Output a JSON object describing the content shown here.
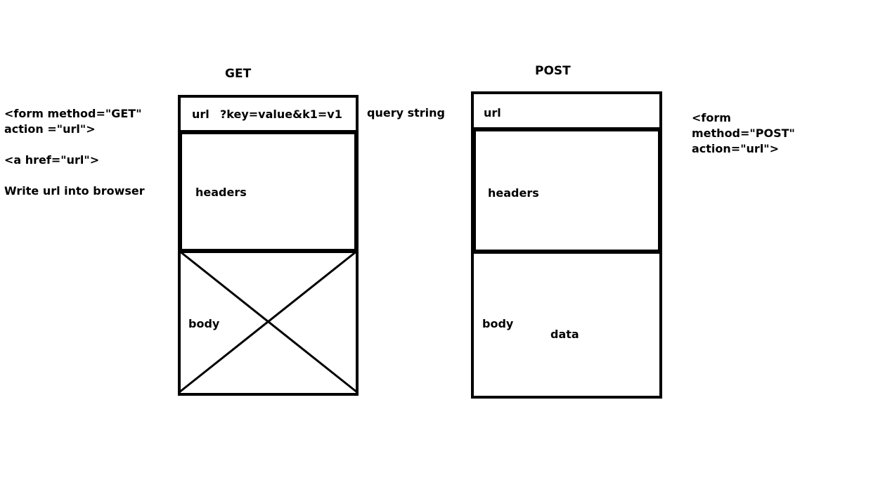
{
  "get": {
    "title": "GET",
    "url_label": "url",
    "query_label": "?key=value&k1=v1",
    "headers_label": "headers",
    "body_label": "body",
    "side_label": "query string",
    "notes": {
      "form_line1": "<form method=\"GET\"",
      "form_line2": "action =\"url\">",
      "anchor": "<a href=\"url\">",
      "browser": "Write url into browser"
    }
  },
  "post": {
    "title": "POST",
    "url_label": "url",
    "headers_label": "headers",
    "body_label": "body",
    "data_label": "data",
    "notes": {
      "line1": "<form",
      "line2": "method=\"POST\"",
      "line3": "action=\"url\">"
    }
  },
  "colors": {
    "stroke": "#000000",
    "background": "#ffffff"
  }
}
